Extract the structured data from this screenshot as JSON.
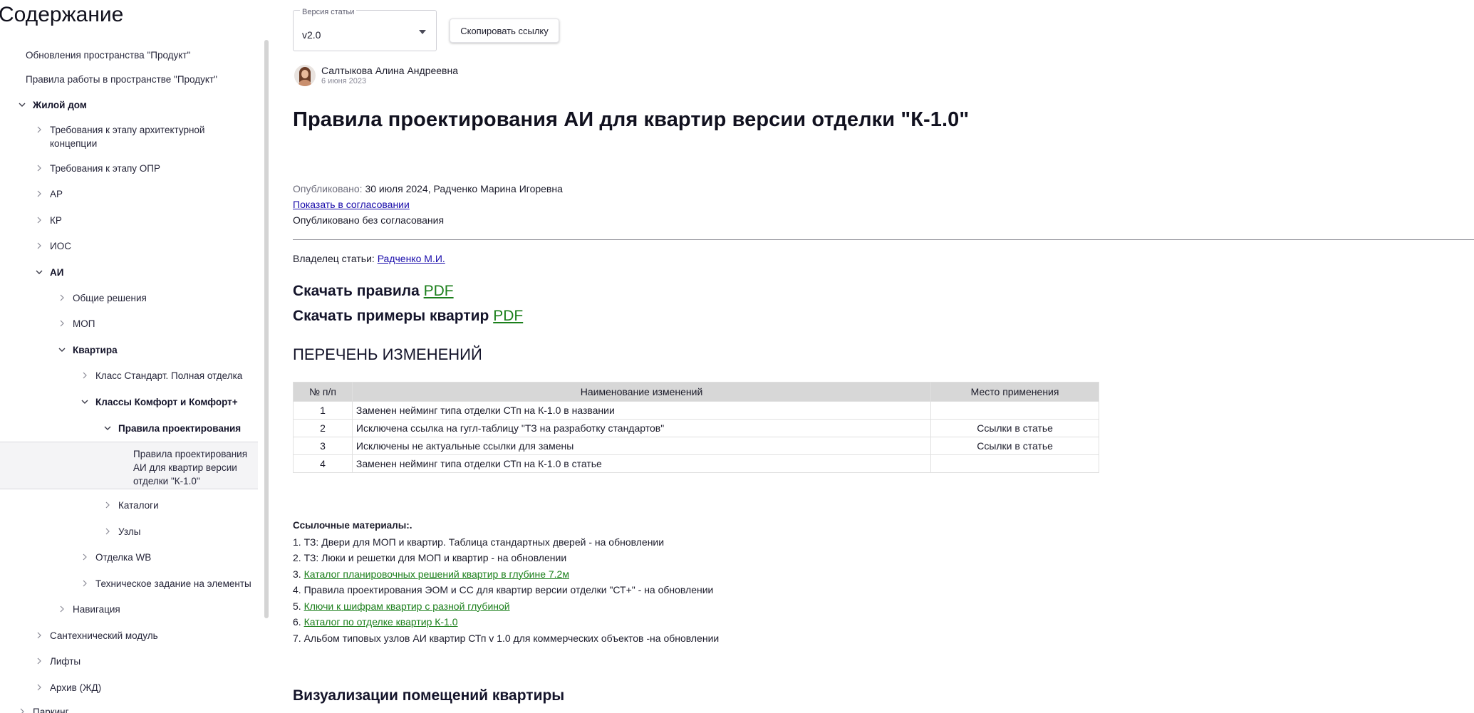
{
  "sidebar": {
    "title": "Содержание",
    "items": [
      {
        "label": "Обновления пространства \"Продукт\"",
        "chevron": "none",
        "bold": false
      },
      {
        "label": "Правила работы в пространстве \"Продукт\"",
        "chevron": "none",
        "bold": false
      },
      {
        "label": "Жилой дом",
        "chevron": "down",
        "bold": true
      },
      {
        "label": "Требования к этапу архитектурной концепции",
        "chevron": "right",
        "bold": false
      },
      {
        "label": "Требования к этапу ОПР",
        "chevron": "right",
        "bold": false
      },
      {
        "label": "АР",
        "chevron": "right",
        "bold": false
      },
      {
        "label": "КР",
        "chevron": "right",
        "bold": false
      },
      {
        "label": "ИОС",
        "chevron": "right",
        "bold": false
      },
      {
        "label": "АИ",
        "chevron": "down",
        "bold": true
      },
      {
        "label": "Общие решения",
        "chevron": "right",
        "bold": false
      },
      {
        "label": "МОП",
        "chevron": "right",
        "bold": false
      },
      {
        "label": "Квартира",
        "chevron": "down",
        "bold": true
      },
      {
        "label": "Класс Стандарт. Полная отделка",
        "chevron": "right",
        "bold": false
      },
      {
        "label": "Классы Комфорт и Комфорт+",
        "chevron": "down",
        "bold": true
      },
      {
        "label": "Правила проектирования",
        "chevron": "down",
        "bold": true
      },
      {
        "label": "Правила проектирования АИ для квартир версии отделки \"К-1.0\"",
        "chevron": "none",
        "bold": false,
        "selected": true
      },
      {
        "label": "Каталоги",
        "chevron": "right",
        "bold": false
      },
      {
        "label": "Узлы",
        "chevron": "right",
        "bold": false
      },
      {
        "label": "Отделка WB",
        "chevron": "right",
        "bold": false
      },
      {
        "label": "Техническое задание на элементы",
        "chevron": "right",
        "bold": false
      },
      {
        "label": "Навигация",
        "chevron": "right",
        "bold": false
      },
      {
        "label": "Сантехнический модуль",
        "chevron": "right",
        "bold": false
      },
      {
        "label": "Лифты",
        "chevron": "right",
        "bold": false
      },
      {
        "label": "Архив (ЖД)",
        "chevron": "right",
        "bold": false
      },
      {
        "label": "Паркинг",
        "chevron": "right",
        "bold": false
      }
    ]
  },
  "version": {
    "legend": "Версия статьи",
    "value": "v2.0"
  },
  "copy_button": "Скопировать ссылку",
  "author": {
    "name": "Салтыкова Алина Андреевна",
    "date": "6 июня 2023"
  },
  "title": "Правила проектирования АИ для квартир версии отделки \"К-1.0\"",
  "published": {
    "label": "Опубликовано:",
    "value": "30 июля 2024, Радченко Марина Игоревна",
    "show_approvals": "Показать в согласовании",
    "status": "Опубликовано без согласования"
  },
  "owner": {
    "label": "Владелец статьи:",
    "name": "Радченко М.И."
  },
  "downloads": [
    {
      "text": "Скачать правила",
      "link": "PDF"
    },
    {
      "text": "Скачать примеры квартир",
      "link": "PDF"
    }
  ],
  "changes": {
    "heading": "ПЕРЕЧЕНЬ ИЗМЕНЕНИЙ",
    "headers": [
      "№ п/п",
      "Наименование изменений",
      "Место применения"
    ],
    "rows": [
      [
        "1",
        "Заменен нейминг типа отделки СТп на К-1.0 в названии",
        ""
      ],
      [
        "2",
        "Исключена ссылка на гугл-таблицу \"ТЗ на разработку стандартов\"",
        "Ссылки в статье"
      ],
      [
        "3",
        "Исключены не актуальные ссылки для замены",
        "Ссылки в статье"
      ],
      [
        "4",
        "Заменен нейминг типа отделки СТп на К-1.0 в статье",
        ""
      ]
    ]
  },
  "references": {
    "heading": "Ссылочные материалы:.",
    "items": [
      {
        "prefix": "1. ",
        "text": "ТЗ: Двери для МОП и квартир. Таблица стандартных дверей - на обновлении",
        "link": false
      },
      {
        "prefix": "2. ",
        "text": "ТЗ: Люки и решетки для МОП и квартир - на обновлении",
        "link": false
      },
      {
        "prefix": "3. ",
        "text": "Каталог планировочных решений квартир в глубине 7.2м",
        "link": true
      },
      {
        "prefix": "4. ",
        "text": "Правила проектирования ЭОМ и СС для квартир версии отделки \"СТ+\" - на обновлении",
        "link": false
      },
      {
        "prefix": "5. ",
        "text": "Ключи к шифрам квартир с разной глубиной",
        "link": true
      },
      {
        "prefix": "6. ",
        "text": "Каталог по отделке квартир К-1.0",
        "link": true
      },
      {
        "prefix": "7. ",
        "text": "Альбом типовых узлов АИ квартир СТп v 1.0 для коммерческих объектов -на обновлении",
        "link": false
      }
    ]
  },
  "visualization_heading": "Визуализации помещений квартиры"
}
